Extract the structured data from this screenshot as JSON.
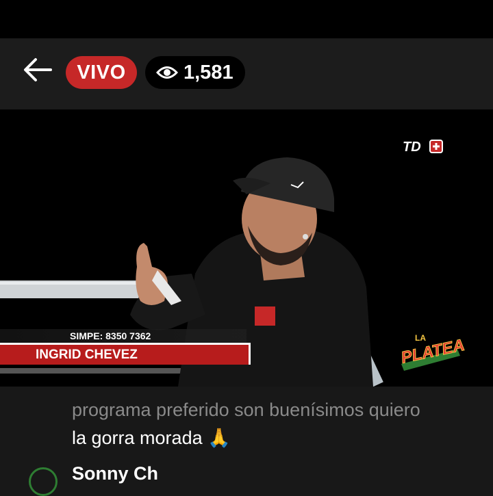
{
  "header": {
    "live_label": "VIVO",
    "viewer_count": "1,581"
  },
  "video": {
    "channel_logo": "TD+",
    "lower_third": {
      "sub": "SIMPE: 8350 7362",
      "name": "INGRID CHEVEZ"
    },
    "show_logo": "LA PLATEA",
    "show_logo_small": "LA",
    "show_logo_main": "PLATEA"
  },
  "chat": {
    "message_line1": "programa preferido son buenísimos quiero",
    "message_line2": "la gorra morada 🙏",
    "next_author": "Sonny Ch"
  },
  "colors": {
    "live_badge": "#c62828",
    "header_bg": "#1c1c1c",
    "lower_third_red": "#b71c1c"
  }
}
